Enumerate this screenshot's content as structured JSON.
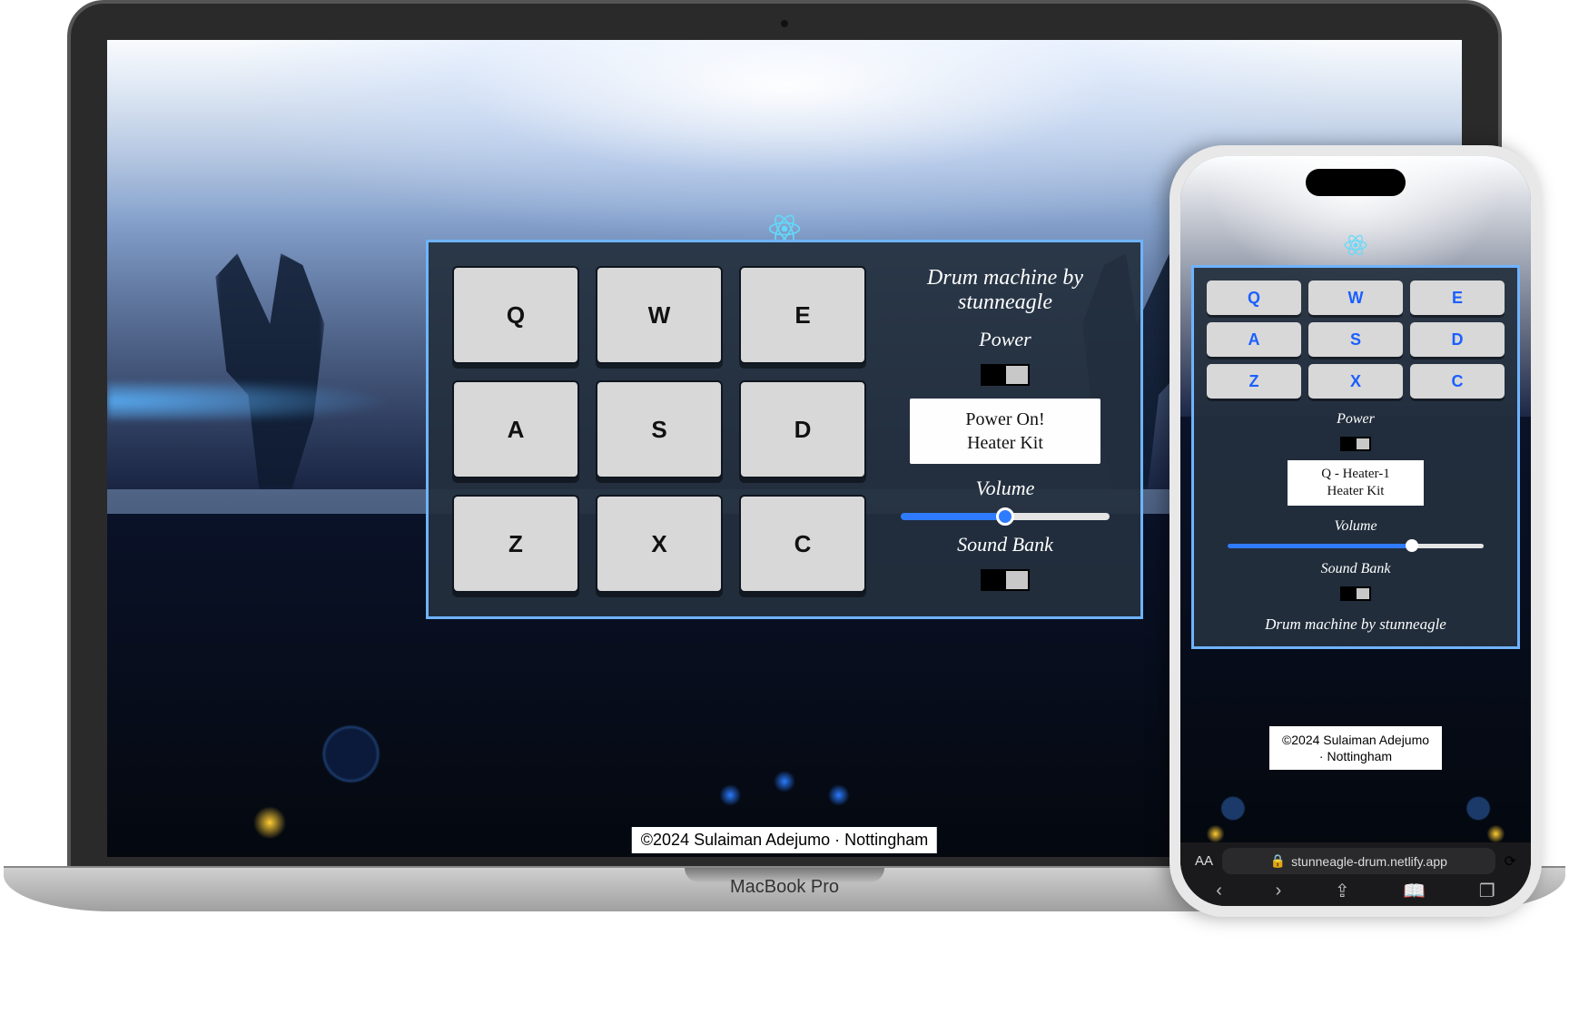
{
  "laptop": {
    "brand": "MacBook Pro"
  },
  "desktop_app": {
    "title": "Drum machine by stunneagle",
    "pads": [
      "Q",
      "W",
      "E",
      "A",
      "S",
      "D",
      "Z",
      "X",
      "C"
    ],
    "power_label": "Power",
    "display_line1": "Power On!",
    "display_line2": "Heater Kit",
    "volume_label": "Volume",
    "volume_value": 50,
    "bank_label": "Sound Bank",
    "credit": "©2024 Sulaiman Adejumo · Nottingham"
  },
  "mobile_app": {
    "pads": [
      "Q",
      "W",
      "E",
      "A",
      "S",
      "D",
      "Z",
      "X",
      "C"
    ],
    "power_label": "Power",
    "display_line1": "Q - Heater-1",
    "display_line2": "Heater Kit",
    "volume_label": "Volume",
    "volume_value": 72,
    "bank_label": "Sound Bank",
    "title": "Drum machine by stunneagle",
    "credit": "©2024 Sulaiman Adejumo · Nottingham",
    "url": "stunneagle-drum.netlify.app",
    "aa": "AA"
  }
}
